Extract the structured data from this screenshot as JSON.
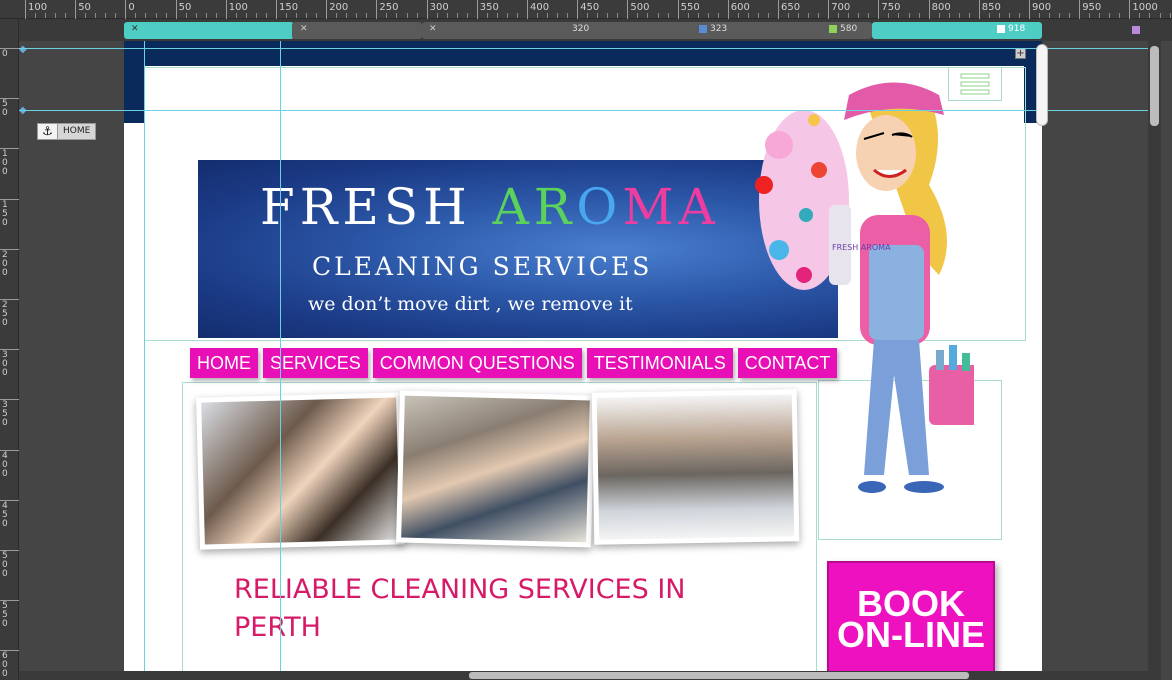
{
  "ruler": {
    "h_labels": [
      "100",
      "50",
      "0",
      "50",
      "100",
      "150",
      "200",
      "250",
      "300",
      "350",
      "400",
      "450",
      "500",
      "550",
      "600",
      "650",
      "700",
      "750",
      "800",
      "850",
      "900",
      "950",
      "1000"
    ],
    "v_labels": [
      "0",
      "50",
      "100",
      "150",
      "200",
      "250",
      "300",
      "350",
      "400",
      "450",
      "500",
      "550",
      "600"
    ]
  },
  "breakpoints": {
    "values": [
      "320",
      "323",
      "580",
      "918"
    ],
    "colors": {
      "teal": "#4ecdc4",
      "blue": "#5b8bd4",
      "green": "#8fd05a",
      "white": "#ffffff",
      "purple": "#b88be0"
    }
  },
  "anchor": {
    "icon": "anchor-icon",
    "label": "HOME"
  },
  "banner": {
    "brand_1": "FRESH ",
    "brand_a": "A",
    "brand_r": "R",
    "brand_o": "O",
    "brand_m": "M",
    "brand_a2": "A",
    "subtitle": "CLEANING SERVICES",
    "tagline": "we don’t move dirt , we remove it"
  },
  "mascot": {
    "bottle_text": "FRESH AROMA"
  },
  "nav": {
    "items": [
      "HOME",
      "SERVICES",
      "COMMON QUESTIONS",
      "TESTIMONIALS",
      "CONTACT"
    ]
  },
  "main": {
    "headline": "RELIABLE CLEANING SERVICES IN PERTH"
  },
  "cta": {
    "line1": "BOOK",
    "line2": "ON-LINE"
  },
  "colors": {
    "accent": "#e70fb5",
    "headline": "#d61a67",
    "navy": "#0a2a5c",
    "guide": "#6ad1e0"
  }
}
